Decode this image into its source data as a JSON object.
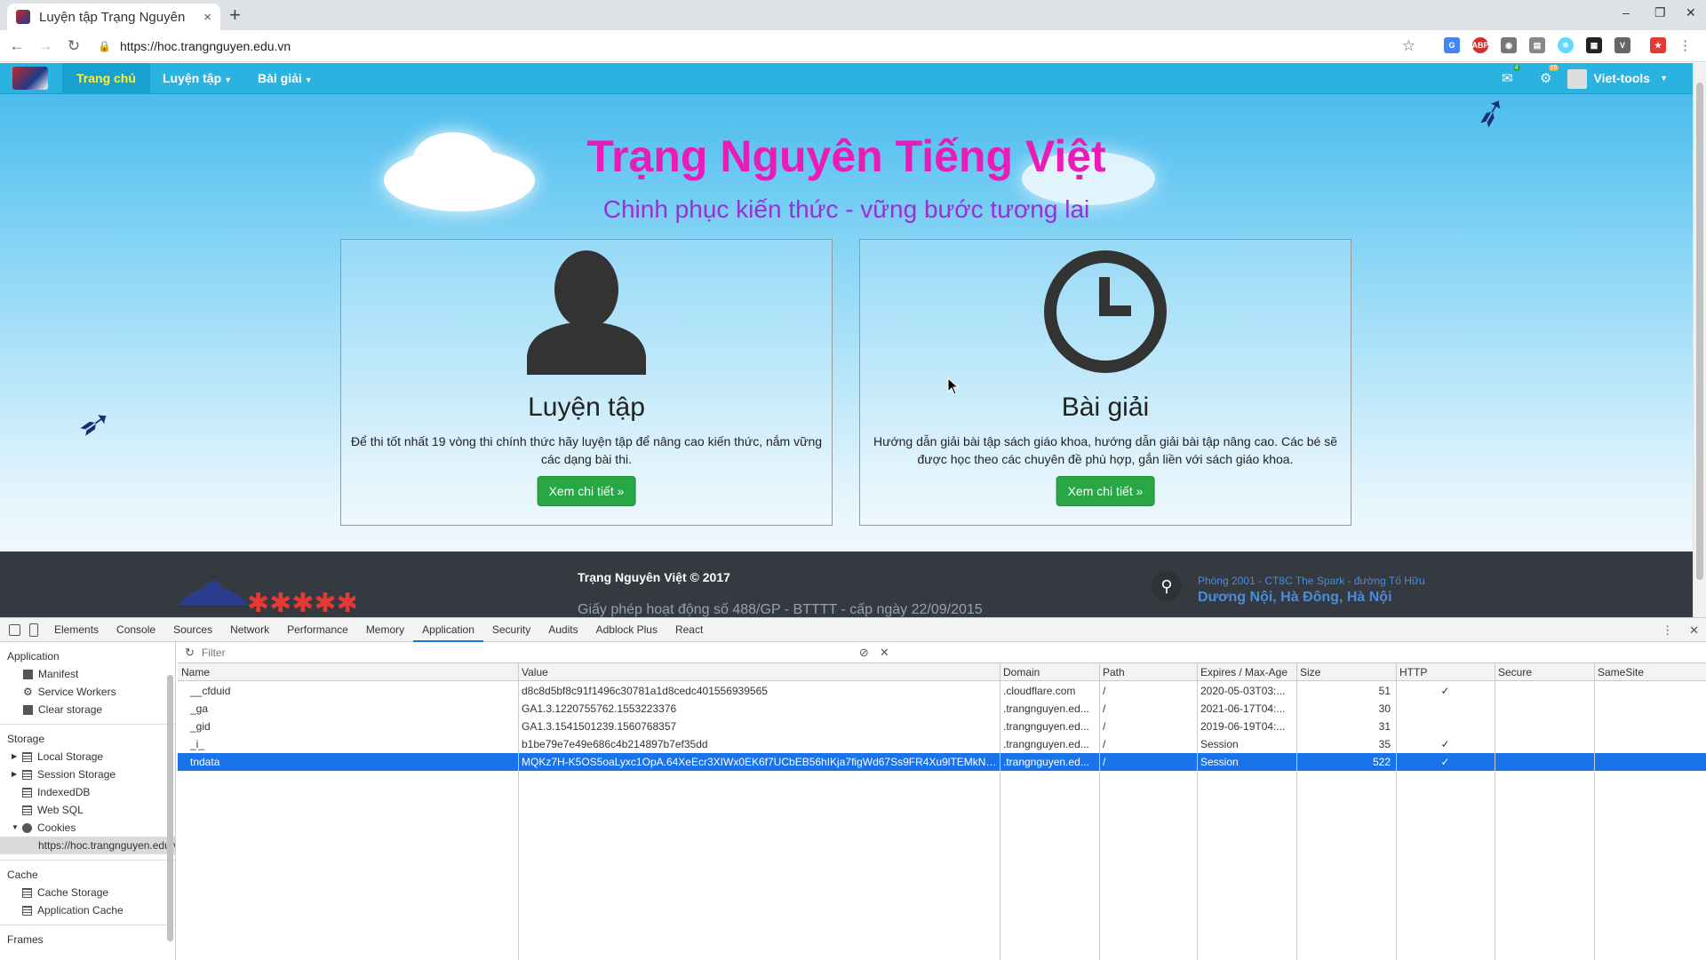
{
  "browser": {
    "tab_title": "Luyện tập Trạng Nguyên",
    "tab_close": "×",
    "new_tab": "+",
    "url": "https://hoc.trangnguyen.edu.vn",
    "win_min": "–",
    "win_max": "❐",
    "win_close": "✕"
  },
  "site_nav": {
    "items": [
      {
        "label": "Trang chủ"
      },
      {
        "label": "Luyện tập"
      },
      {
        "label": "Bài giải"
      }
    ],
    "mail_badge": "4",
    "notif_badge": "10",
    "user": "Viet-tools"
  },
  "hero": {
    "title": "Trạng Nguyên Tiếng Việt",
    "subtitle": "Chinh phục kiến thức - vững bước tương lai"
  },
  "cards": [
    {
      "title": "Luyện tập",
      "text": "Để thi tốt nhất 19 vòng thi chính thức hãy luyện tập để nâng cao kiến thức, nắm vững các dạng bài thi.",
      "button": "Xem chi tiết »",
      "icon": "user-icon"
    },
    {
      "title": "Bài giải",
      "text": "Hướng dẫn giải bài tập sách giáo khoa, hướng dẫn giải bài tập nâng cao. Các bé sẽ được học theo các chuyên đề phù hợp, gắn liền với sách giáo khoa.",
      "button": "Xem chi tiết »",
      "icon": "clock-icon"
    }
  ],
  "footer": {
    "brand": "Trạng Nguyên Việt © 2017",
    "license": "Giấy phép hoạt động số 488/GP - BTTTT - cấp ngày 22/09/2015",
    "address1": "Phòng 2001 - CT8C The Spark - đường Tố Hữu",
    "address2": "Dương Nội, Hà Đông, Hà Nội"
  },
  "devtools": {
    "tabs": [
      "Elements",
      "Console",
      "Sources",
      "Network",
      "Performance",
      "Memory",
      "Application",
      "Security",
      "Audits",
      "Adblock Plus",
      "React"
    ],
    "active_tab": "Application",
    "sidebar": {
      "application_header": "Application",
      "application_items": [
        "Manifest",
        "Service Workers",
        "Clear storage"
      ],
      "storage_header": "Storage",
      "storage_items": [
        "Local Storage",
        "Session Storage",
        "IndexedDB",
        "Web SQL",
        "Cookies"
      ],
      "cookie_origin": "https://hoc.trangnguyen.edu.vn",
      "cache_header": "Cache",
      "cache_items": [
        "Cache Storage",
        "Application Cache"
      ],
      "frames_header": "Frames"
    },
    "filter_placeholder": "Filter",
    "columns": [
      "Name",
      "Value",
      "Domain",
      "Path",
      "Expires / Max-Age",
      "Size",
      "HTTP",
      "Secure",
      "SameSite"
    ],
    "rows": [
      {
        "name": "__cfduid",
        "value": "d8c8d5bf8c91f1496c30781a1d8cedc401556939565",
        "domain": ".cloudflare.com",
        "path": "/",
        "expires": "2020-05-03T03:...",
        "size": "51",
        "http": "✓",
        "secure": "",
        "samesite": ""
      },
      {
        "name": "_ga",
        "value": "GA1.3.1220755762.1553223376",
        "domain": ".trangnguyen.ed...",
        "path": "/",
        "expires": "2021-06-17T04:...",
        "size": "30",
        "http": "",
        "secure": "",
        "samesite": ""
      },
      {
        "name": "_gid",
        "value": "GA1.3.1541501239.1560768357",
        "domain": ".trangnguyen.ed...",
        "path": "/",
        "expires": "2019-06-19T04:...",
        "size": "31",
        "http": "",
        "secure": "",
        "samesite": ""
      },
      {
        "name": "_i_",
        "value": "b1be79e7e49e686c4b214897b7ef35dd",
        "domain": ".trangnguyen.ed...",
        "path": "/",
        "expires": "Session",
        "size": "35",
        "http": "✓",
        "secure": "",
        "samesite": ""
      },
      {
        "name": "tndata",
        "value": "MQKz7H-K5OS5oaLyxc1OpA.64XeEcr3XIWx0EK6f7UCbEB56hIKja7figWd67Ss9FR4Xu9lTEMkNn...",
        "domain": ".trangnguyen.ed...",
        "path": "/",
        "expires": "Session",
        "size": "522",
        "http": "✓",
        "secure": "",
        "samesite": ""
      }
    ],
    "selected_row": "tndata"
  }
}
